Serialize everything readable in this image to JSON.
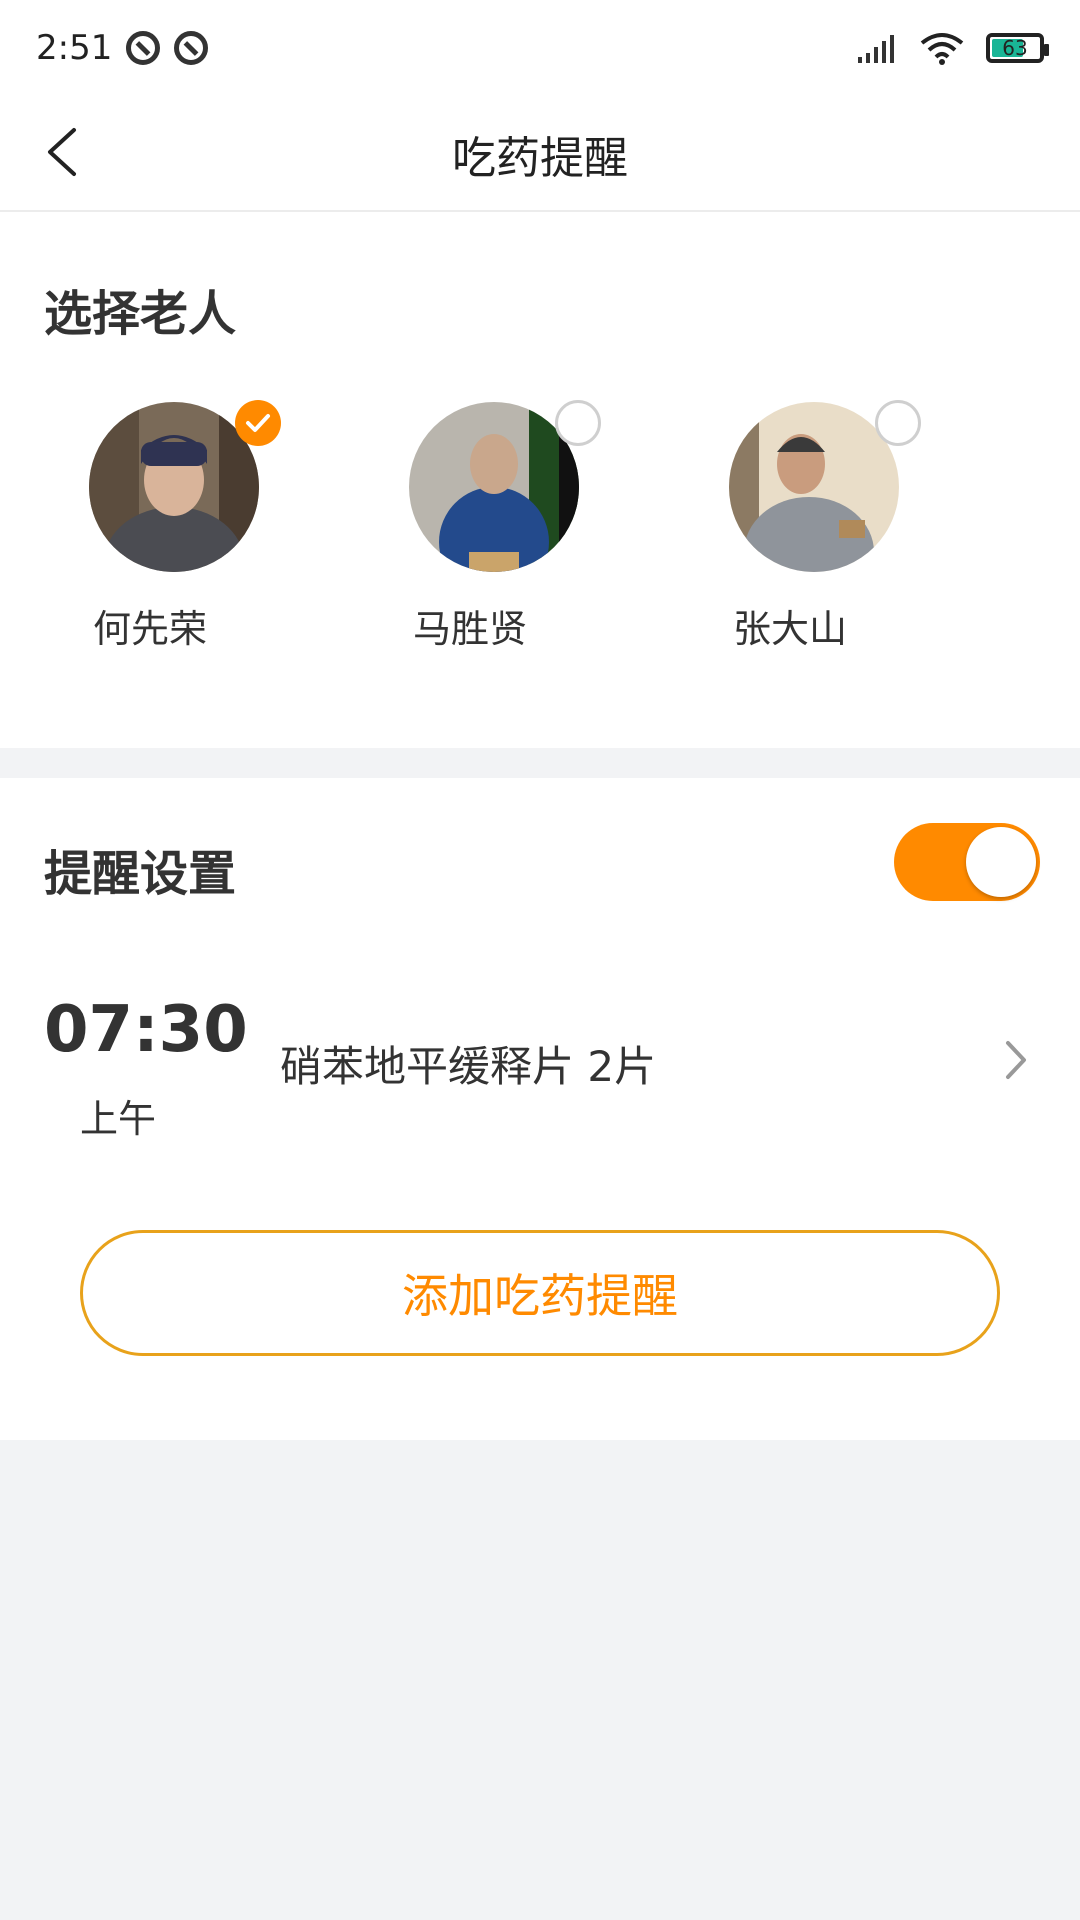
{
  "status_bar": {
    "time": "2:51",
    "battery_level": "63",
    "icons": [
      "notification-icon",
      "notification-icon",
      "signal-icon",
      "wifi-icon",
      "battery-icon"
    ]
  },
  "nav": {
    "title": "吃药提醒",
    "back_icon": "chevron-left-icon"
  },
  "select_elder": {
    "title": "选择老人",
    "people": [
      {
        "name": "何先荣",
        "selected": true
      },
      {
        "name": "马胜贤",
        "selected": false
      },
      {
        "name": "张大山",
        "selected": false
      }
    ]
  },
  "reminder_settings": {
    "title": "提醒设置",
    "enabled": true,
    "reminders": [
      {
        "time": "07:30",
        "period": "上午",
        "medicine": "硝苯地平缓释片 2片"
      }
    ],
    "add_button_label": "添加吃药提醒"
  },
  "colors": {
    "accent": "#ff8a00",
    "button_border": "#e8a21b",
    "page_background": "#f2f3f5"
  }
}
